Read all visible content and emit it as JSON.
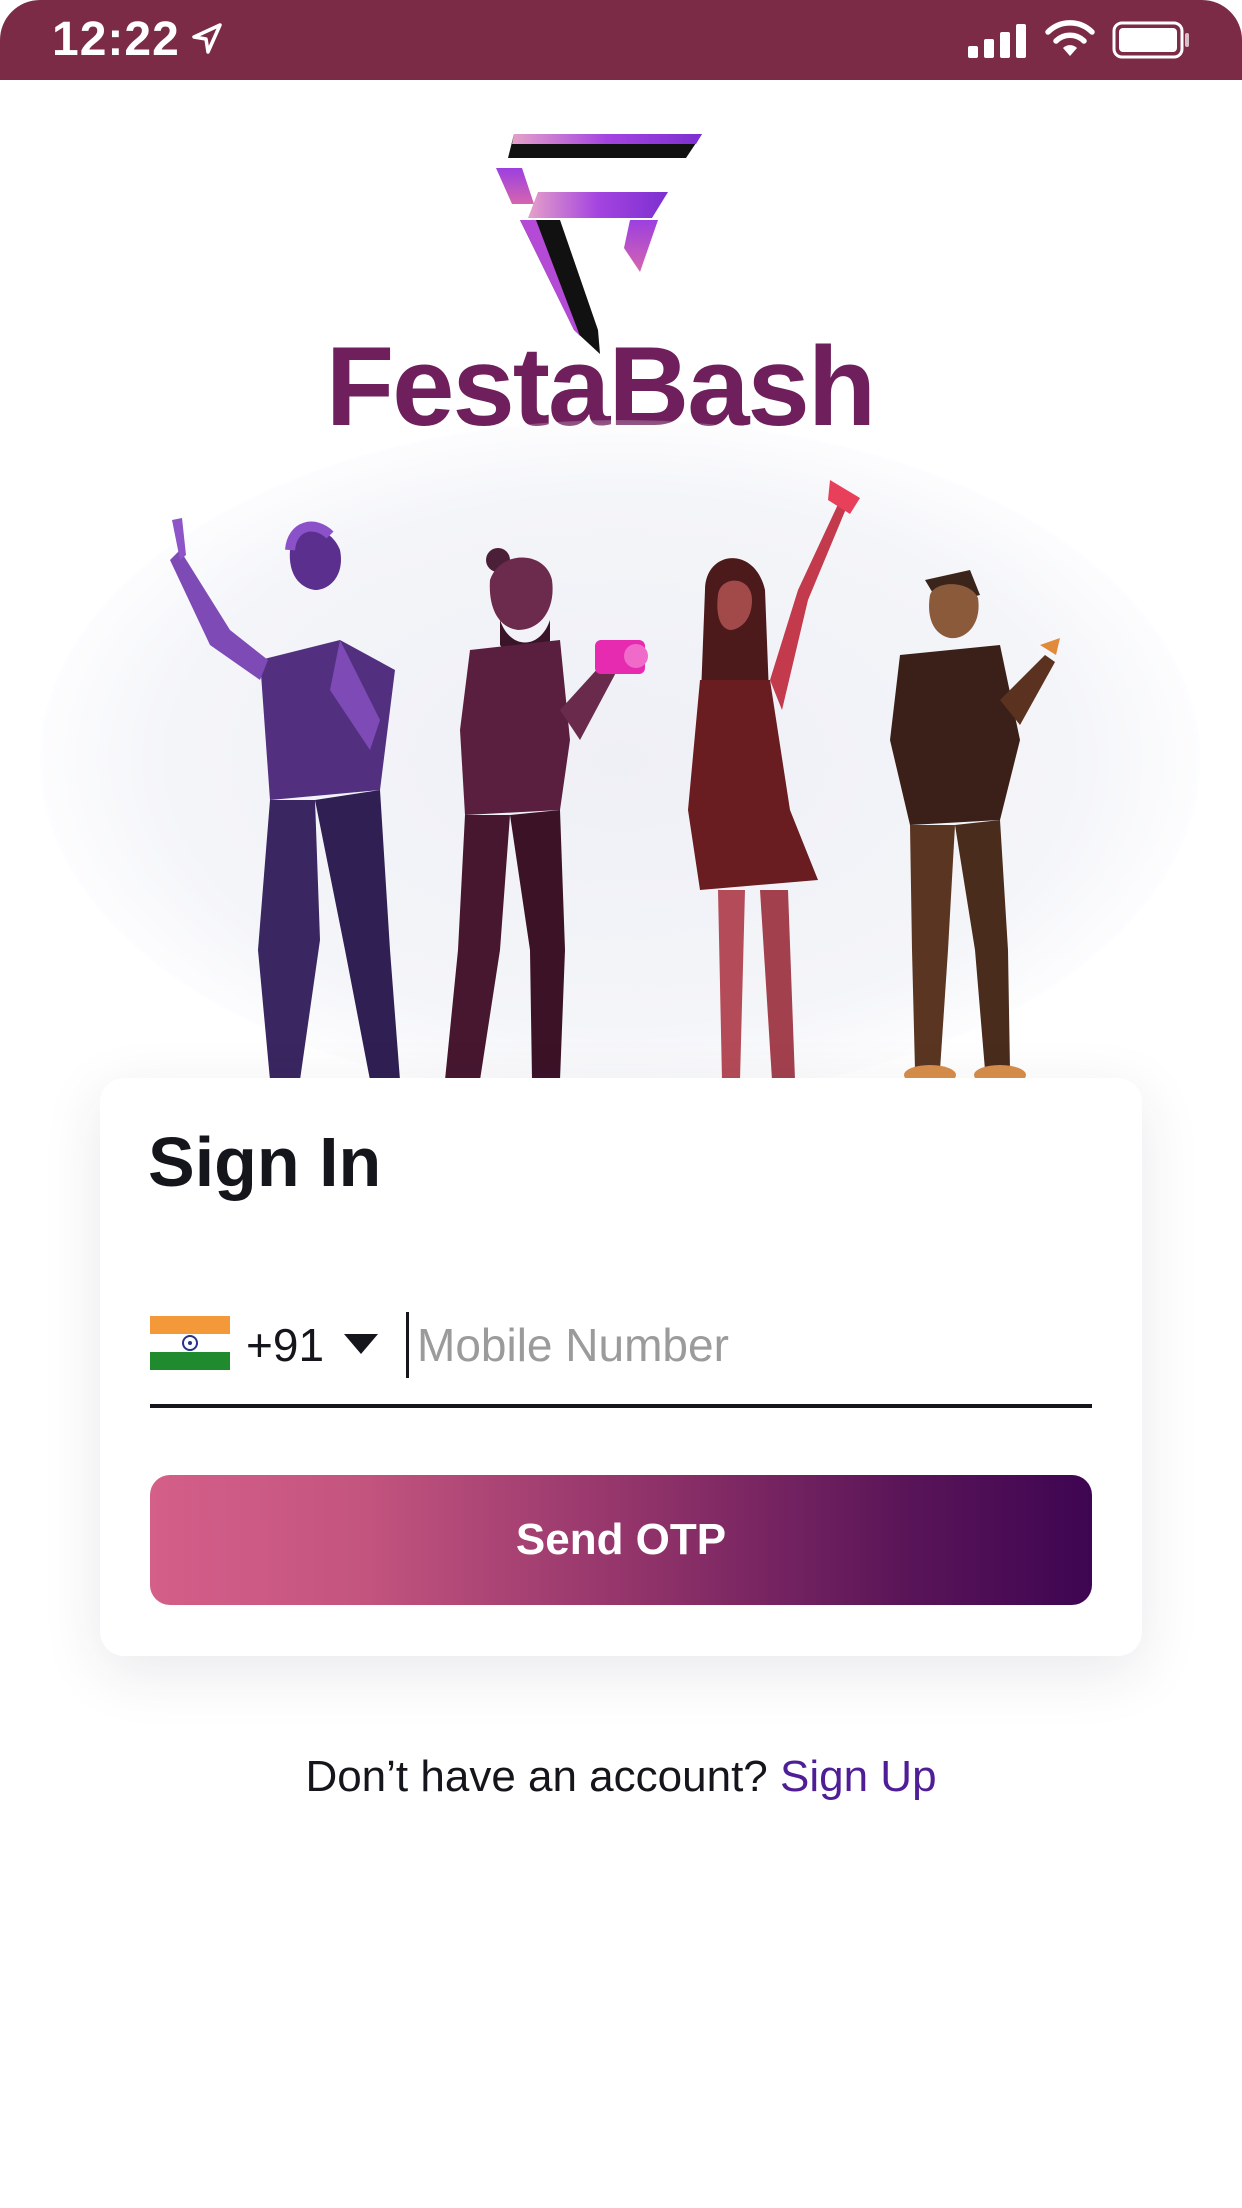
{
  "status_bar": {
    "time": "12:22",
    "icons": [
      "location-arrow-icon",
      "cellular-signal-icon",
      "wifi-icon",
      "battery-icon"
    ]
  },
  "brand": {
    "name": "FestaBash",
    "logo": "festabash-f-logo",
    "colors": {
      "brand_text": "#6e1f5c",
      "header": "#7b2b46"
    }
  },
  "hero": {
    "illustration": "group-of-four-friends-taking-selfies"
  },
  "signin": {
    "title": "Sign In",
    "country_flag": "india-flag-icon",
    "country_code": "+91",
    "mobile_placeholder": "Mobile Number",
    "send_button": "Send OTP",
    "button_gradient": [
      "#d45f89",
      "#3e0552"
    ]
  },
  "footer": {
    "prompt": "Don’t have an account?",
    "signup_link": "Sign Up",
    "link_color": "#4f1e96"
  }
}
